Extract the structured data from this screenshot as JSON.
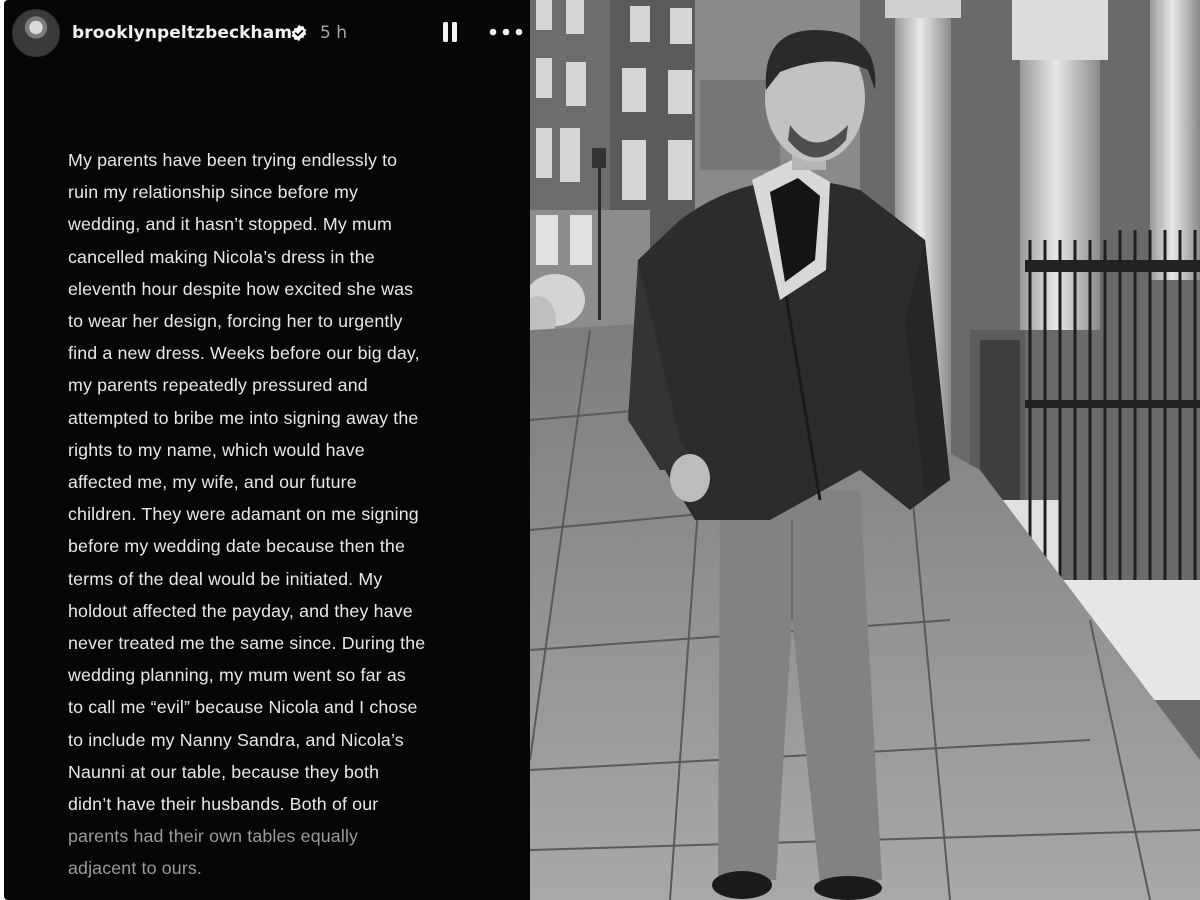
{
  "story": {
    "username": "brooklynpeltzbeckham",
    "time": "5 h",
    "icons": {
      "verified": "verified-badge-icon",
      "pause": "pause-icon",
      "more": "more-options-icon",
      "avatar": "profile-avatar"
    },
    "text_lines": [
      "My parents have been trying endlessly to",
      "ruin my relationship since before my",
      "wedding, and it hasn’t stopped. My mum",
      "cancelled making Nicola’s dress in the",
      "eleventh hour despite how excited she was",
      "to wear her design, forcing her to urgently",
      "find a new dress. Weeks before our big day,",
      "my parents repeatedly pressured and",
      "attempted to bribe me into signing away the",
      "rights to my name, which would have",
      "affected me, my wife, and our future",
      "children. They were adamant on me signing",
      "before my wedding date because then the",
      "terms of the deal would be initiated. My",
      "holdout affected the payday, and they have",
      "never treated me the same since. During the",
      "wedding planning, my mum went so far as",
      "to call me “evil” because Nicola and I chose",
      "to include my Nanny Sandra, and Nicola’s",
      "Naunni at our table, because they both",
      "didn’t have their husbands. Both of our",
      "parents had their own tables equally",
      "adjacent to ours."
    ]
  },
  "photo": {
    "subject": "black-and-white photo of a man walking on a city sidewalk"
  },
  "colors": {
    "panel_bg": "#060606",
    "text": "#e8e8e8",
    "muted": "#a5a5a5"
  }
}
